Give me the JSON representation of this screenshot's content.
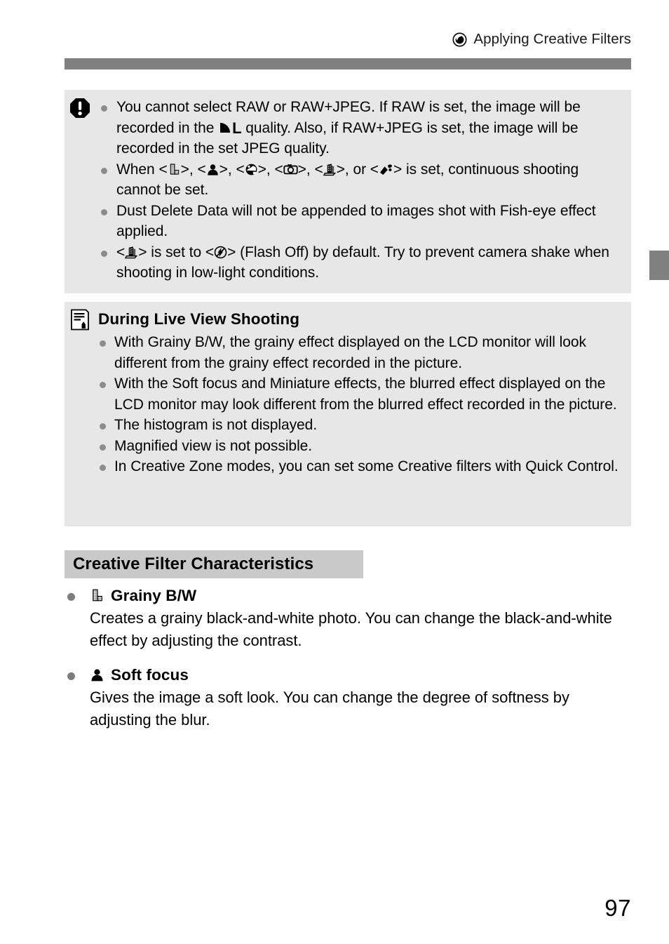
{
  "page": {
    "number": "97",
    "running_head": "Applying Creative Filters",
    "running_head_icon": "creative-filter-sphere-icon"
  },
  "warning_box": {
    "icon": "warning-exclamation-icon",
    "bullets": [
      {
        "id": "raw-not-selectable",
        "parts": [
          {
            "type": "text",
            "value": "You cannot select RAW or RAW+JPEG. If RAW is set, the image will be recorded in the "
          },
          {
            "type": "icon",
            "value": "quality-fine-large-icon"
          },
          {
            "type": "bold",
            "value": "L"
          },
          {
            "type": "text",
            "value": " quality. Also, if RAW+JPEG is set, the image will be recorded in the set JPEG quality."
          }
        ]
      },
      {
        "id": "continuous-shooting-limit",
        "parts": [
          {
            "type": "text",
            "value": "When <"
          },
          {
            "type": "icon",
            "value": "grainy-bw-filter-icon"
          },
          {
            "type": "text",
            "value": ">, <"
          },
          {
            "type": "icon",
            "value": "soft-focus-filter-icon"
          },
          {
            "type": "text",
            "value": ">, <"
          },
          {
            "type": "icon",
            "value": "fish-eye-filter-icon"
          },
          {
            "type": "text",
            "value": ">, <"
          },
          {
            "type": "icon",
            "value": "toy-camera-filter-icon"
          },
          {
            "type": "text",
            "value": ">, <"
          },
          {
            "type": "icon",
            "value": "miniature-filter-icon"
          },
          {
            "type": "text",
            "value": ">, or <"
          },
          {
            "type": "icon",
            "value": "art-bold-filter-icon"
          },
          {
            "type": "text",
            "value": "> is set, continuous shooting cannot be set."
          }
        ]
      },
      {
        "id": "dust-delete-data",
        "parts": [
          {
            "type": "text",
            "value": "Dust Delete Data will not be appended to images shot with Fish-eye effect applied."
          }
        ]
      },
      {
        "id": "flash-off-default",
        "parts": [
          {
            "type": "text",
            "value": "<"
          },
          {
            "type": "icon",
            "value": "miniature-filter-icon"
          },
          {
            "type": "text",
            "value": "> is set to <"
          },
          {
            "type": "icon",
            "value": "flash-off-icon"
          },
          {
            "type": "text",
            "value": "> (Flash Off) by default. Try to prevent camera shake when shooting in low-light conditions."
          }
        ]
      }
    ]
  },
  "liveview_box": {
    "icon": "memo-note-icon",
    "heading": "During Live View Shooting",
    "bullets": [
      "With Grainy B/W, the grainy effect displayed on the LCD monitor will look different from the grainy effect recorded in the picture.",
      "With the Soft focus and Miniature effects, the blurred effect displayed on the LCD monitor may look different from the blurred effect recorded in the picture.",
      "The histogram is not displayed.",
      "Magnified view is not possible.",
      "In Creative Zone modes, you can set some Creative filters with Quick Control."
    ]
  },
  "section": {
    "heading": "Creative Filter Characteristics",
    "filters": [
      {
        "icon": "grainy-bw-filter-icon",
        "title": "Grainy B/W",
        "description": "Creates a grainy black-and-white photo. You can change the black-and-white effect by adjusting the contrast."
      },
      {
        "icon": "soft-focus-filter-icon",
        "title": "Soft focus",
        "description": "Gives the image a soft look. You can change the degree of softness by adjusting the blur."
      }
    ]
  },
  "colors": {
    "note_background": "#e7e7e7",
    "heading_background": "#c9c9c9",
    "rule": "#808080",
    "bullet": "#8c8c8c",
    "text": "#000000"
  }
}
